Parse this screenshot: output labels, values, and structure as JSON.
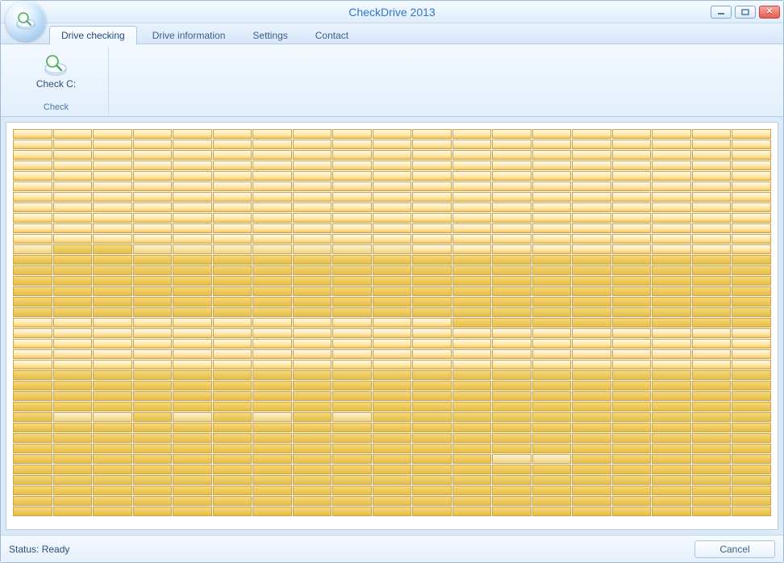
{
  "title": "CheckDrive 2013",
  "tabs": [
    {
      "label": "Drive checking"
    },
    {
      "label": "Drive information"
    },
    {
      "label": "Settings"
    },
    {
      "label": "Contact"
    }
  ],
  "ribbon": {
    "check_group_label": "Check",
    "check_button_label": "Check C:"
  },
  "footer": {
    "status": "Status: Ready",
    "cancel": "Cancel"
  },
  "grid": {
    "cols": 19,
    "rows": [
      "VVVVVVVVVVVVVVVVVVV",
      "VVVVVVVVVVVVVVVVVVV",
      "VVVVVVVVVVVVVVVVVVV",
      "VVVVVVVVVVVVVVVVVVV",
      "VVVVVVVVVVVVVVVVVVV",
      "VVVVVVVVVVVVVVVVVVV",
      "VVVVVVVVVVVVVVVVVVV",
      "VVVVVVVVVVVVVVVVVVV",
      "VVVVVVVVVVVVVVVVVVV",
      "VVVVVVVVVVVVVVVVVVV",
      "VVVVVVVVVVVVVVVVVVV",
      "LSSLLLLLLLVVVVVVVVV",
      "SSSSSSSSSSSSSSSSSSS",
      "SSSSSSSSSSSSSSSSSSS",
      "SSSSSSSSSSSSSSSSSSS",
      "SSSSSSSSSSSSSSSSSSS",
      "SSSSSSSSSSSSSSSSSSS",
      "SSSSSSSSSSSSSSSSSSS",
      "VVVVVVVVVVVSSSSSSSS",
      "VVVVVVVVVVVVVVVVVVV",
      "VVVVVVVVVVVVVVVVVVV",
      "VVVVVVVVVVVVVVVVVVV",
      "VVVVVVVVVVVVVVVVVVV",
      "SSSSSSSSSSSSSSSSSSS",
      "SSSSSSSSSSSSSSSSSSS",
      "SSSSSSSSSSSSSSSSSSS",
      "SSSSSSSSSSSSSSSSSSS",
      "SLLSLSLSLSSSSSSSSSS",
      "SSSSSSSSSSSSSSSSSSS",
      "SSSSSSSSSSSSSSSSSSS",
      "SSSSSSSSSSSSSSSSSSS",
      "SSSSSSSSSSSSLLSSSSS",
      "SSSSSSSSSSSSSSSSSSS",
      "SSSSSSSSSSSSSSSSSSS",
      "SSSSSSSSSSSSSSSSSSS",
      "SSSSSSSSSSSSSSSSSSS",
      "SSSSSSSSSSSSSSSSSSS"
    ]
  }
}
